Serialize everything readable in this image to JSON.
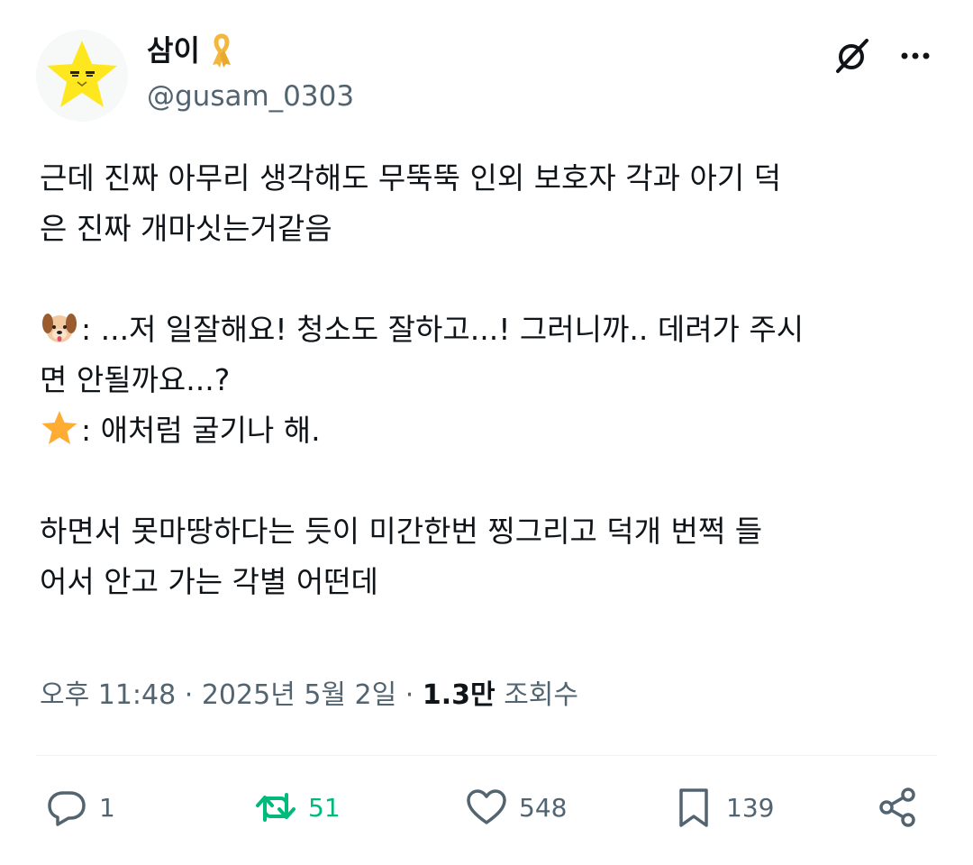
{
  "author": {
    "display_name": "삼이",
    "handle": "@gusam_0303",
    "avatar_icon": "yellow-star-face-avatar",
    "badge_icon": "yellow-ribbon-icon"
  },
  "header_icons": {
    "grok": "grok-icon",
    "more": "more-icon"
  },
  "tweet": {
    "line1": "근데 진짜 아무리 생각해도 무뚝뚝 인외 보호자 각과 아기 덕",
    "line2": "은 진짜 개마싯는거같음",
    "line3": ": ...저 일잘해요! 청소도 잘하고...! 그러니까.. 데려가 주시",
    "line4": "면 안될까요...?",
    "line5": ": 애처럼 굴기나 해.",
    "line6": "하면서 못마땅하다는 듯이 미간한번 찡그리고 덕개 번쩍 들",
    "line7": "어서 안고 가는 각별 어떤데",
    "emoji_dog": "dog-face-emoji",
    "emoji_star": "star-emoji"
  },
  "meta": {
    "time": "오후 11:48",
    "date": "2025년 5월 2일",
    "views_count": "1.3만",
    "views_label": "조회수",
    "separator": "·"
  },
  "actions": {
    "reply_count": "1",
    "retweet_count": "51",
    "like_count": "548",
    "bookmark_count": "139"
  },
  "colors": {
    "text": "#0f1419",
    "secondary": "#536471",
    "retweet_green": "#00ba7c",
    "star_yellow": "#ffe71f"
  }
}
